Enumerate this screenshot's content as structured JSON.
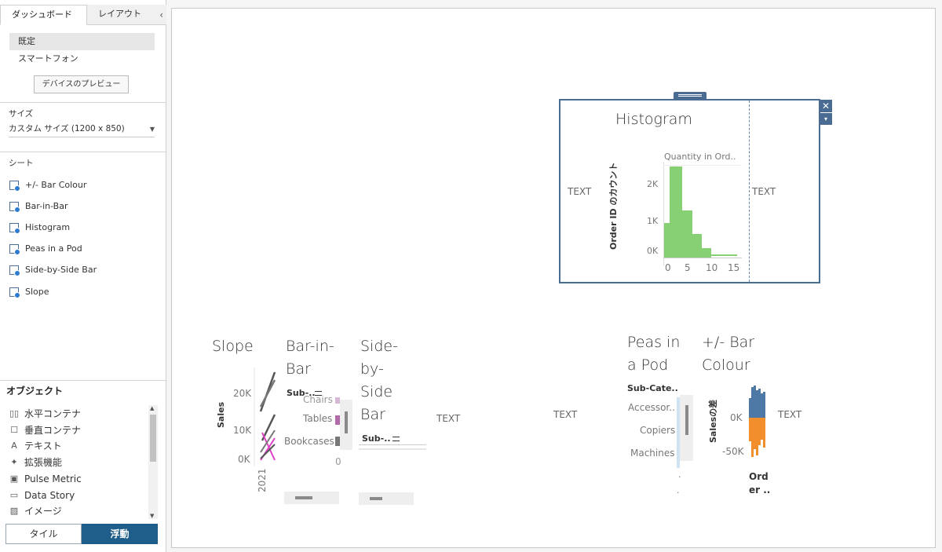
{
  "pane": {
    "tabs": {
      "dashboard": "ダッシュボード",
      "layout": "レイアウト"
    },
    "collapse_icon": "‹",
    "devices": [
      "既定",
      "スマートフォン"
    ],
    "preview_button": "デバイスのプレビュー",
    "size_label": "サイズ",
    "size_value": "カスタム サイズ (1200 x 850)",
    "sheets_label": "シート",
    "sheets": [
      "+/- Bar Colour",
      "Bar-in-Bar",
      "Histogram",
      "Peas in a Pod",
      "Side-by-Side Bar",
      "Slope"
    ],
    "objects_label": "オブジェクト",
    "objects": [
      "水平コンテナ",
      "垂直コンテナ",
      "テキスト",
      "拡張機能",
      "Pulse Metric",
      "Data Story",
      "イメージ"
    ],
    "tile_button": "タイル",
    "float_button": "浮動"
  },
  "canvas": {
    "histogram": {
      "title": "Histogram",
      "x_field": "Quantity in Ord..",
      "y_label": "Order ID のカウント",
      "y_ticks": [
        "2K",
        "1K",
        "0K"
      ],
      "x_ticks": [
        "0",
        "5",
        "10",
        "15"
      ],
      "text_left": "TEXT",
      "text_right": "TEXT",
      "close_icon": "✕",
      "menu_icon": "▾"
    },
    "slope": {
      "title": "Slope",
      "y_label": "Sales",
      "y_ticks": [
        "20K",
        "10K",
        "0K"
      ],
      "x_tick": "2021"
    },
    "bar_in_bar": {
      "title_lines": [
        "Bar-in-",
        "Bar"
      ],
      "header": "Sub-..",
      "rows": [
        "Chairs",
        "Tables",
        "Bookcases"
      ],
      "axis_tick": "0"
    },
    "side_by_side": {
      "title_lines": [
        "Side-",
        "by-",
        "Side",
        "Bar"
      ],
      "header": "Sub-.."
    },
    "text_blocks": [
      "TEXT",
      "TEXT",
      "TEXT"
    ],
    "peas": {
      "title_lines": [
        "Peas in",
        "a Pod"
      ],
      "header": "Sub-Cate..",
      "rows": [
        "Accessor..",
        "Copiers",
        "Machines"
      ]
    },
    "plus_minus": {
      "title_lines": [
        "+/- Bar",
        "Colour"
      ],
      "y_label": "Salesの差",
      "y_ticks": [
        "0K",
        "-50K"
      ],
      "x_label_lines": [
        "Ord",
        "er .."
      ]
    },
    "colors": {
      "accent": "#4a6c93",
      "float_button": "#1f5e8a",
      "histogram_bar": "#86cf73",
      "positive": "#4e79a7",
      "negative": "#f28e2b",
      "slope_pink": "#e040c8"
    }
  }
}
